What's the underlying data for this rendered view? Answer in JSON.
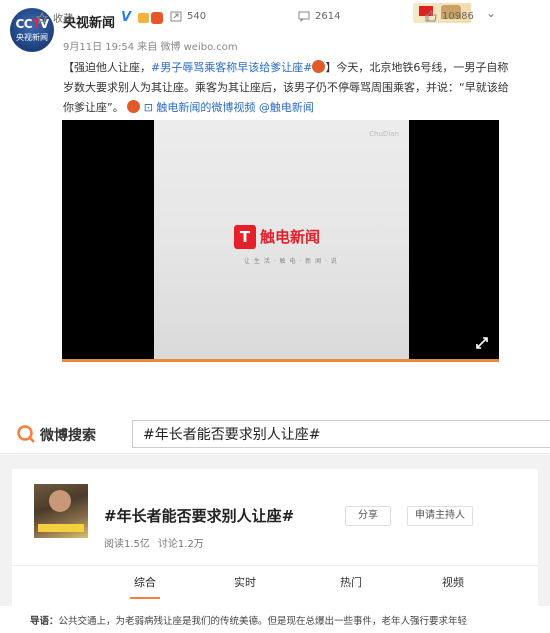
{
  "post": {
    "avatar": {
      "logo": "CCTV",
      "sub": "央视新闻"
    },
    "username": "央视新闻",
    "verified_mark": "V",
    "meta": "9月11日 19:54 来自 微博 weibo.com",
    "text_parts": {
      "p1": "【强迫他人让座，",
      "hashtag": "#男子辱骂乘客称早该给爹让座#",
      "p2": "】今天，北京地铁6号线，一男子自称岁数大要求别人为其让座。乘客为其让座后，该男子仍不停辱骂周围乘客，并说：“早就该给你爹让座”。",
      "video_link": "触电新闻的微博视频",
      "mention": "@触电新闻"
    },
    "video": {
      "watermark": "ChuDian",
      "logo_mark": "T",
      "logo_text": "触电新闻",
      "tagline": "让 生 活 · 触 电 · 新 闻 · 说"
    },
    "actions": {
      "favorite": "收藏",
      "repost": "540",
      "comment": "2614",
      "like": "10986"
    }
  },
  "search": {
    "title": "微博搜索",
    "query": "#年长者能否要求别人让座#"
  },
  "topic": {
    "title": "#年长者能否要求别人让座#",
    "share": "分享",
    "host": "申请主持人",
    "reads": "阅读1.5亿",
    "discussions": "讨论1.2万",
    "tabs": [
      "综合",
      "实时",
      "热门",
      "视频"
    ],
    "guide_label": "导语：",
    "guide_text": "公共交通上，为老弱病残让座是我们的传统美德。但是现在总爆出一些事件，老年人强行要求年轻"
  },
  "colors": {
    "link": "#2a6cc6",
    "accent_orange": "#fa7d3c",
    "brand_red": "#e4202a"
  }
}
